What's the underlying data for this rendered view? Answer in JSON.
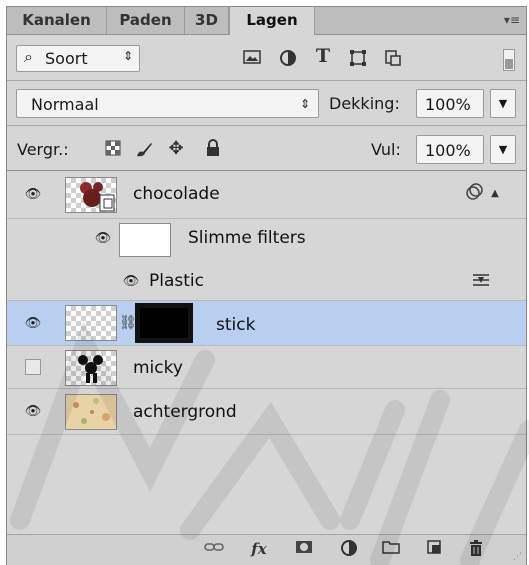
{
  "tabs": [
    {
      "label": "Kanalen"
    },
    {
      "label": "Paden"
    },
    {
      "label": "3D"
    },
    {
      "label": "Lagen",
      "active": true
    }
  ],
  "filter": {
    "search_glyph": "⌕",
    "kind_label": "Soort",
    "icons": [
      "image-filter-icon",
      "adjustment-filter-icon",
      "type-filter-icon",
      "shape-filter-icon",
      "smart-object-filter-icon"
    ],
    "type_glyph": "T"
  },
  "blend": {
    "mode": "Normaal",
    "opacity_label": "Dekking:",
    "opacity_value": "100%",
    "fill_label": "Vul:",
    "fill_value": "100%"
  },
  "lock": {
    "label": "Vergr.:",
    "icons": [
      "lock-transparent-icon",
      "lock-image-icon",
      "lock-position-icon",
      "lock-all-icon"
    ]
  },
  "layers": [
    {
      "name": "chocolade",
      "visible": true,
      "selected": false
    },
    {
      "name": "Slimme filters",
      "visible": true,
      "selected": false
    },
    {
      "name": "Plastic",
      "visible": true,
      "selected": false
    },
    {
      "name": "stick",
      "visible": true,
      "selected": true
    },
    {
      "name": "micky",
      "visible": false,
      "selected": false
    },
    {
      "name": "achtergrond",
      "visible": true,
      "selected": false
    }
  ],
  "bottom_icons": [
    "link-layers-icon",
    "fx-icon",
    "add-mask-icon",
    "adjustment-layer-icon",
    "new-group-icon",
    "new-layer-icon",
    "delete-layer-icon"
  ],
  "bottom_fx_label": "fx",
  "colors": {
    "selection": "#b9cff0",
    "panel_bg": "#d6d6d6",
    "tabbar_bg": "#bdbdbd"
  }
}
